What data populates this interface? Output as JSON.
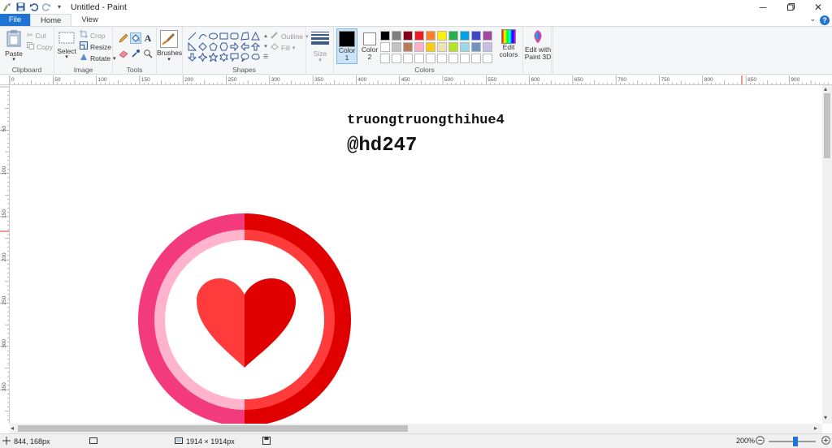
{
  "window": {
    "title": "Untitled - Paint"
  },
  "tabs": {
    "file": "File",
    "home": "Home",
    "view": "View"
  },
  "clipboard": {
    "paste": "Paste",
    "cut": "Cut",
    "copy": "Copy",
    "label": "Clipboard"
  },
  "image": {
    "select": "Select",
    "crop": "Crop",
    "resize": "Resize",
    "rotate": "Rotate",
    "label": "Image"
  },
  "tools": {
    "label": "Tools"
  },
  "brushes": {
    "label": "Brushes"
  },
  "shapes": {
    "outline": "Outline",
    "fill": "Fill",
    "label": "Shapes"
  },
  "size": {
    "label": "Size"
  },
  "colors": {
    "color1": "Color 1",
    "color2": "Color 2",
    "edit": "Edit colors",
    "paint3d": "Edit with Paint 3D",
    "label": "Colors",
    "color1_value": "#000000",
    "color2_value": "#ffffff",
    "palette": [
      "#000000",
      "#7f7f7f",
      "#880015",
      "#ed1c24",
      "#ff7f27",
      "#fff200",
      "#22b14c",
      "#00a2e8",
      "#3f48cc",
      "#a349a4",
      "#ffffff",
      "#c3c3c3",
      "#b97a57",
      "#ffaec9",
      "#ffc90e",
      "#efe4b0",
      "#b5e61d",
      "#99d9ea",
      "#7092be",
      "#c8bfe7",
      "#ffffff",
      "#ffffff",
      "#ffffff",
      "#ffffff",
      "#ffffff",
      "#ffffff",
      "#ffffff",
      "#ffffff",
      "#ffffff",
      "#ffffff"
    ]
  },
  "ruler": {
    "top": [
      "0",
      "50",
      "100",
      "150",
      "200",
      "250",
      "300",
      "350",
      "400",
      "450",
      "500",
      "550",
      "600",
      "650",
      "700",
      "750",
      "800",
      "850",
      "900"
    ],
    "left": [
      "50",
      "100",
      "150",
      "200",
      "250",
      "300",
      "350"
    ]
  },
  "canvas": {
    "line1": "truongtruongthihue4",
    "line2": "@hd247"
  },
  "status": {
    "cursor": "844, 168px",
    "dimensions": "1914 × 1914px",
    "zoom": "200%"
  }
}
